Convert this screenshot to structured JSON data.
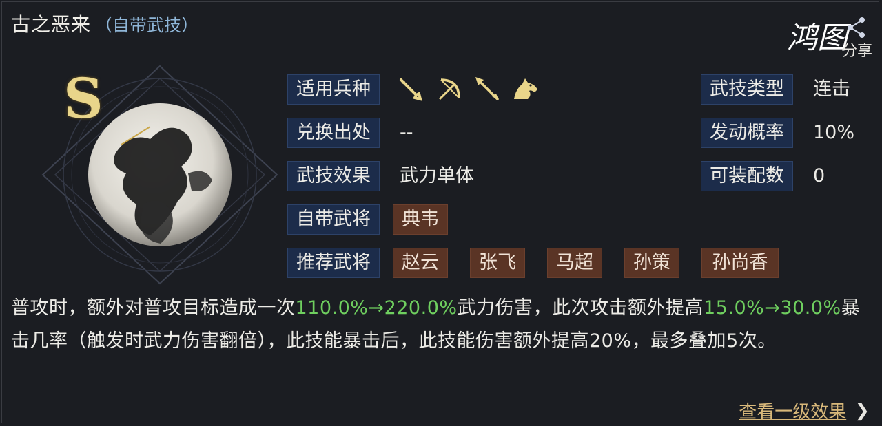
{
  "header": {
    "title": "古之恶来",
    "subtitle": "（自带武技）",
    "logo_text": "鸿图",
    "share_text": "分享"
  },
  "skill": {
    "grade": "S"
  },
  "rows": {
    "troop_label": "适用兵种",
    "troop_icons": [
      "sword-icon",
      "bow-icon",
      "spear-icon",
      "horse-icon"
    ],
    "source_label": "兑换出处",
    "source_value": "--",
    "effect_label": "武技效果",
    "effect_value": "武力单体",
    "own_general_label": "自带武将",
    "own_general": "典韦",
    "recommend_label": "推荐武将",
    "recommend": [
      "赵云",
      "张飞",
      "马超",
      "孙策",
      "孙尚香"
    ],
    "type_label": "武技类型",
    "type_value": "连击",
    "rate_label": "发动概率",
    "rate_value": "10%",
    "slots_label": "可装配数",
    "slots_value": "0"
  },
  "description": {
    "p1": "普攻时，额外对普攻目标造成一次",
    "g1": "110.0%→220.0%",
    "p2": "武力伤害，此次攻击额外提高",
    "g2": "15.0%→30.0%",
    "p3": "暴击几率（触发时武力伤害翻倍），此技能暴击后，此技能伤害额外提高20%，最多叠加5次。"
  },
  "footer": {
    "more_label": "查看一级效果"
  },
  "colors": {
    "label_bg": "#1c2c4a",
    "tag_bg": "#5a3425",
    "highlight": "#6fcf5f",
    "gold": "#e9d58a"
  }
}
